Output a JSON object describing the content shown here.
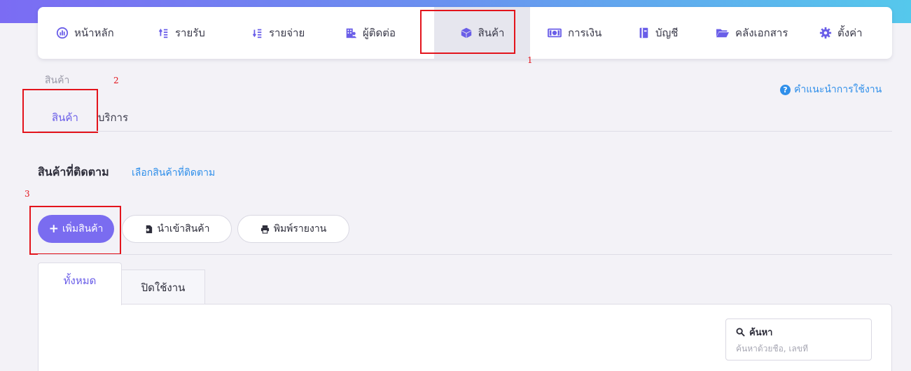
{
  "nav": {
    "items": [
      {
        "label": "หน้าหลัก",
        "icon": "dashboard-icon"
      },
      {
        "label": "รายรับ",
        "icon": "income-icon"
      },
      {
        "label": "รายจ่าย",
        "icon": "expense-icon"
      },
      {
        "label": "ผู้ติดต่อ",
        "icon": "contacts-icon"
      },
      {
        "label": "สินค้า",
        "icon": "box-icon",
        "active": true
      },
      {
        "label": "การเงิน",
        "icon": "money-icon"
      },
      {
        "label": "บัญชี",
        "icon": "ledger-icon"
      },
      {
        "label": "คลังเอกสาร",
        "icon": "folder-icon"
      },
      {
        "label": "ตั้งค่า",
        "icon": "gear-icon"
      }
    ]
  },
  "annotations": [
    "1",
    "2",
    "3"
  ],
  "breadcrumb": "สินค้า",
  "help_link": "คำแนะนำการใช้งาน",
  "subtabs": [
    "สินค้า",
    "บริการ"
  ],
  "followed": {
    "title": "สินค้าที่ติดตาม",
    "link": "เลือกสินค้าที่ติดตาม"
  },
  "buttons": {
    "add_product": "เพิ่มสินค้า",
    "import_product": "นำเข้าสินค้า",
    "print_report": "พิมพ์รายงาน"
  },
  "table_tabs": [
    "ทั้งหมด",
    "ปิดใช้งาน"
  ],
  "search": {
    "label": "ค้นหา",
    "placeholder": "ค้นหาด้วยชื่อ, เลขที่"
  },
  "colors": {
    "accent": "#7a6cf0",
    "link": "#2f8fea",
    "annotation": "#e3141c"
  }
}
